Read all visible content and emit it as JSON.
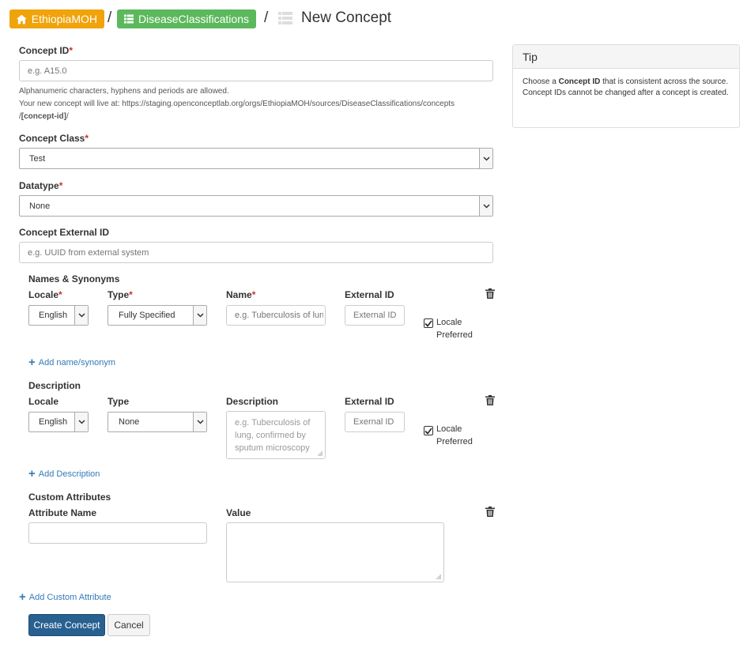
{
  "breadcrumb": {
    "org": {
      "label": "EthiopiaMOH",
      "color": "#f0a30a"
    },
    "source": {
      "label": "DiseaseClassifications",
      "color": "#5cb85c"
    },
    "separator": "/",
    "current": "New Concept"
  },
  "form": {
    "concept_id": {
      "label": "Concept ID",
      "required_mark": "*",
      "placeholder": "e.g. A15.0",
      "help_1": "Alphanumeric characters, hyphens and periods are allowed.",
      "help_2": "Your new concept will live at: https://staging.openconceptlab.org/orgs/EthiopiaMOH/sources/DiseaseClassifications/concepts",
      "help_3_prefix": "/",
      "help_3_bold": "[concept-id]",
      "help_3_suffix": "/"
    },
    "concept_class": {
      "label": "Concept Class",
      "required_mark": "*",
      "value": "Test"
    },
    "datatype": {
      "label": "Datatype",
      "required_mark": "*",
      "value": "None"
    },
    "external_id": {
      "label": "Concept External ID",
      "placeholder": "e.g. UUID from external system"
    }
  },
  "names": {
    "heading": "Names & Synonyms",
    "locale_label": "Locale",
    "type_label": "Type",
    "name_label": "Name",
    "external_id_label": "External ID",
    "required_mark": "*",
    "locale_value": "English",
    "type_value": "Fully Specified",
    "name_placeholder": "e.g. Tuberculosis of lung",
    "external_id_placeholder": "External ID",
    "preferred_line1": "Locale",
    "preferred_line2": "Preferred",
    "add_label": "Add name/synonym"
  },
  "description": {
    "heading": "Description",
    "locale_label": "Locale",
    "type_label": "Type",
    "description_label": "Description",
    "external_id_label": "External ID",
    "locale_value": "English",
    "type_value": "None",
    "description_placeholder": "e.g. Tuberculosis of lung, confirmed by sputum microscopy",
    "external_id_placeholder": "Exernal ID",
    "preferred_line1": "Locale",
    "preferred_line2": "Preferred",
    "add_label": "Add Description"
  },
  "custom": {
    "heading": "Custom Attributes",
    "name_label": "Attribute Name",
    "value_label": "Value",
    "add_label": "Add Custom Attribute"
  },
  "buttons": {
    "create": "Create Concept",
    "cancel": "Cancel"
  },
  "tip": {
    "title": "Tip",
    "text_1": "Choose a ",
    "text_bold": "Concept ID",
    "text_2": " that is consistent across the source. Concept IDs cannot be changed after a concept is created."
  },
  "colors": {
    "primary": "#286090",
    "link": "#337ab7",
    "required": "#c9302c"
  }
}
